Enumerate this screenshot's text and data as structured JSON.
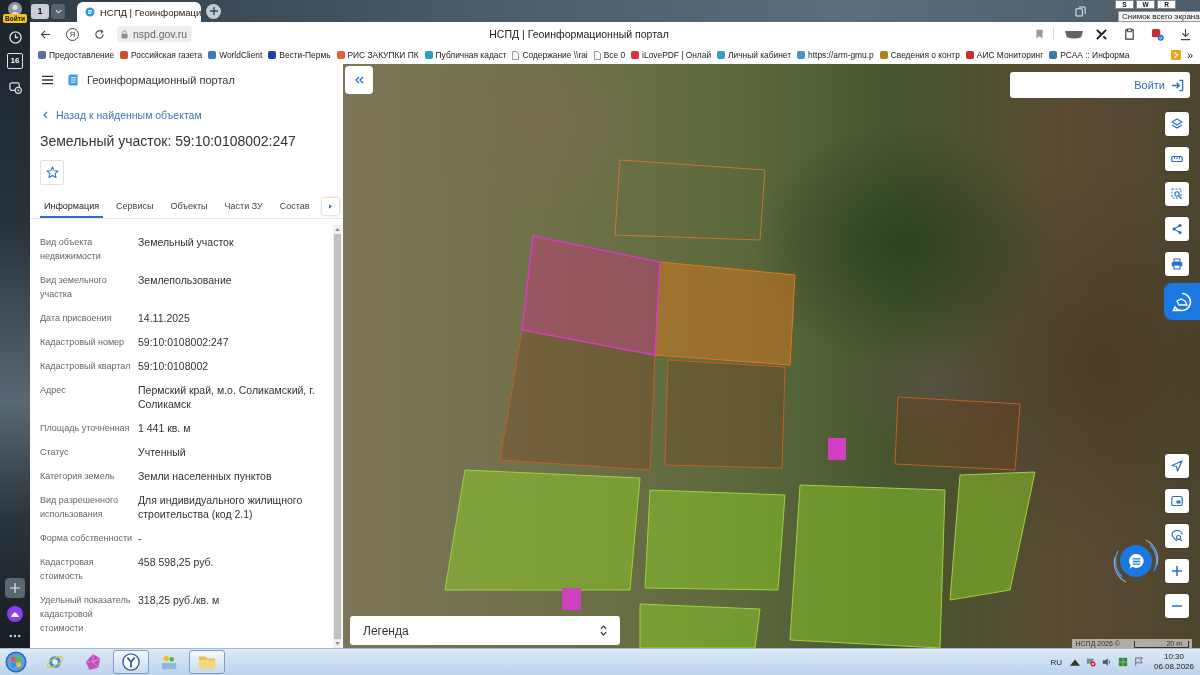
{
  "browser": {
    "profile_label": "Войти",
    "tab_count": "1",
    "tabs": [
      {
        "title": "НСПД | Геоинформаци",
        "selected": true
      }
    ],
    "screenshot_keys": [
      "S",
      "W",
      "R"
    ],
    "tooltip": "Снимок всего экрана",
    "home_label": "Я",
    "address": "nspd.gov.ru",
    "page_title": "НСПД | Геоинформационный портал",
    "bookmarks": [
      {
        "label": "Предоставление",
        "kind": "site",
        "color": "#5a6fa0"
      },
      {
        "label": "Российская газета",
        "kind": "site",
        "color": "#d0502a"
      },
      {
        "label": "WorldClient",
        "kind": "site",
        "color": "#3a7ab8"
      },
      {
        "label": "Вести-Пермь",
        "kind": "site",
        "color": "#1f3fa8"
      },
      {
        "label": "РИС ЗАКУПКИ ПК",
        "kind": "site",
        "color": "#e0603a"
      },
      {
        "label": "Публичная кадаст",
        "kind": "site",
        "color": "#2aa0c0"
      },
      {
        "label": "Содержание \\\\rai",
        "kind": "page"
      },
      {
        "label": "Все 0",
        "kind": "page"
      },
      {
        "label": "iLovePDF | Онлай",
        "kind": "site",
        "color": "#e03040"
      },
      {
        "label": "Личный кабинет",
        "kind": "site",
        "color": "#3a9ad0"
      },
      {
        "label": "https://arm-gmu.p",
        "kind": "site",
        "color": "#4a90d0"
      },
      {
        "label": "Сведения о контр",
        "kind": "site",
        "color": "#b08020"
      },
      {
        "label": "АИС Мониторинг",
        "kind": "site",
        "color": "#d02a2a"
      },
      {
        "label": "РСАА :: Информа",
        "kind": "site",
        "color": "#3a7aa0"
      }
    ],
    "bookmarks_more": "»"
  },
  "browser_sidebar": {
    "calendar_day": "16"
  },
  "portal": {
    "header_title": "Геоинформационный портал",
    "back_link": "Назад к найденным объектам",
    "title": "Земельный участок: 59:10:0108002:247",
    "favorite": false,
    "tabs": [
      {
        "label": "Информация",
        "selected": true
      },
      {
        "label": "Сервисы",
        "selected": false
      },
      {
        "label": "Объекты",
        "selected": false
      },
      {
        "label": "Части ЗУ",
        "selected": false
      },
      {
        "label": "Состав",
        "selected": false
      }
    ],
    "fields": [
      {
        "label": "Вид объекта недвижимости",
        "value": "Земельный участок"
      },
      {
        "label": "Вид земельного участка",
        "value": "Землепользование"
      },
      {
        "label": "Дата присвоения",
        "value": "14.11.2025"
      },
      {
        "label": "Кадастровый номер",
        "value": "59:10:0108002:247"
      },
      {
        "label": "Кадастровый квартал",
        "value": "59:10:0108002"
      },
      {
        "label": "Адрес",
        "value": "Пермский край, м.о. Соликамский, г. Соликамск"
      },
      {
        "label": "Площадь уточненная",
        "value": "1 441 кв. м"
      },
      {
        "label": "Статус",
        "value": "Учтенный"
      },
      {
        "label": "Категория земель",
        "value": "Земли населенных пунктов"
      },
      {
        "label": "Вид разрешенного использования",
        "value": "Для индивидуального жилищного строительства (код 2.1)"
      },
      {
        "label": "Форма собственности",
        "value": "-"
      },
      {
        "label": "Кадастровая стоимость",
        "value": "458 598,25 руб."
      },
      {
        "label": "Удельный показатель кадастровой стоимости",
        "value": "318,25 руб./кв. м"
      }
    ]
  },
  "map": {
    "login_button": "Войти",
    "legend": "Легенда",
    "attribution": "НСПД 2026 ©",
    "scale": "20 m"
  },
  "taskbar": {
    "apps": [
      {
        "kind": "orbit",
        "running": false
      },
      {
        "kind": "gem",
        "running": false
      },
      {
        "kind": "ybrowser",
        "running": true
      },
      {
        "kind": "chat",
        "running": false
      },
      {
        "kind": "folder",
        "running": true
      }
    ],
    "language": "RU",
    "time": "10:30",
    "date": "06.08.2026"
  }
}
